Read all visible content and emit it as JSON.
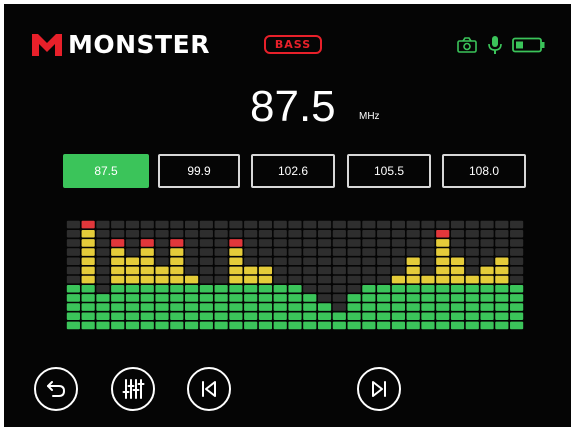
{
  "header": {
    "brand": "MONSTER",
    "badge": "BASS",
    "status_icons": [
      "camera-icon",
      "microphone-icon",
      "battery-icon"
    ]
  },
  "tuner": {
    "frequency": "87.5",
    "unit": "MHz"
  },
  "presets": [
    {
      "label": "87.5",
      "active": true
    },
    {
      "label": "99.9",
      "active": false
    },
    {
      "label": "102.6",
      "active": false
    },
    {
      "label": "105.5",
      "active": false
    },
    {
      "label": "108.0",
      "active": false
    }
  ],
  "equalizer": {
    "rows": 12,
    "levels": [
      5,
      12,
      4,
      10,
      8,
      10,
      7,
      10,
      6,
      5,
      5,
      10,
      7,
      7,
      5,
      5,
      4,
      3,
      2,
      4,
      5,
      5,
      6,
      8,
      6,
      11,
      8,
      6,
      7,
      8,
      5
    ],
    "colors": {
      "background": "#2e2e2e",
      "green": "#3bc45a",
      "yellow": "#e5cc3a",
      "red": "#e2373b"
    }
  },
  "controls": [
    {
      "name": "back-button",
      "icon": "back-arrow-icon"
    },
    {
      "name": "equalizer-button",
      "icon": "sliders-icon"
    },
    {
      "name": "previous-button",
      "icon": "skip-previous-icon"
    },
    {
      "name": "next-button",
      "icon": "skip-next-icon"
    }
  ]
}
